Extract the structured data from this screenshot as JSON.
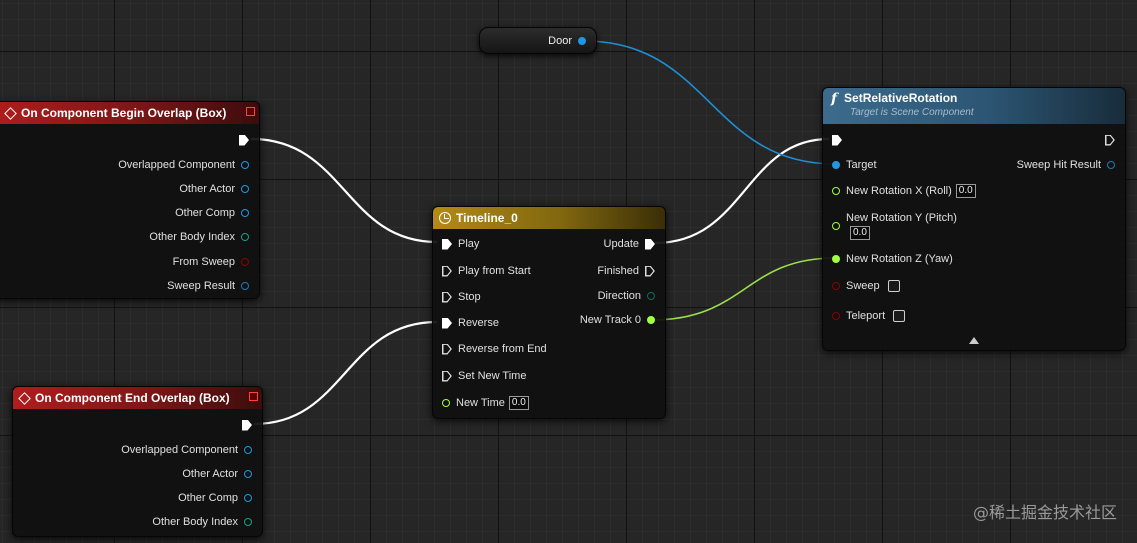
{
  "colors": {
    "object_pin": "#1e98e6",
    "float_pin": "#a0ff3c",
    "bool_pin": "#8c0000",
    "struct_pin": "#0fa58c",
    "exec_wire": "#ffffff"
  },
  "begin_overlap": {
    "title": "On Component Begin Overlap (Box)",
    "pins": [
      "Overlapped Component",
      "Other Actor",
      "Other Comp",
      "Other Body Index",
      "From Sweep",
      "Sweep Result"
    ]
  },
  "end_overlap": {
    "title": "On Component End Overlap (Box)",
    "pins": [
      "Overlapped Component",
      "Other Actor",
      "Other Comp",
      "Other Body Index"
    ]
  },
  "door": {
    "label": "Door"
  },
  "timeline": {
    "title": "Timeline_0",
    "inputs": [
      "Play",
      "Play from Start",
      "Stop",
      "Reverse",
      "Reverse from End",
      "Set New Time"
    ],
    "new_time_label": "New Time",
    "new_time_value": "0.0",
    "outputs": [
      "Update",
      "Finished",
      "Direction",
      "New Track 0"
    ]
  },
  "set_rotation": {
    "title": "SetRelativeRotation",
    "subtitle": "Target is Scene Component",
    "target_label": "Target",
    "sweep_hit_label": "Sweep Hit Result",
    "rot_x_label": "New Rotation X (Roll)",
    "rot_x_value": "0.0",
    "rot_y_label": "New Rotation Y (Pitch)",
    "rot_y_value": "0.0",
    "rot_z_label": "New Rotation Z (Yaw)",
    "sweep_label": "Sweep",
    "teleport_label": "Teleport"
  },
  "watermark": "@稀土掘金技术社区"
}
